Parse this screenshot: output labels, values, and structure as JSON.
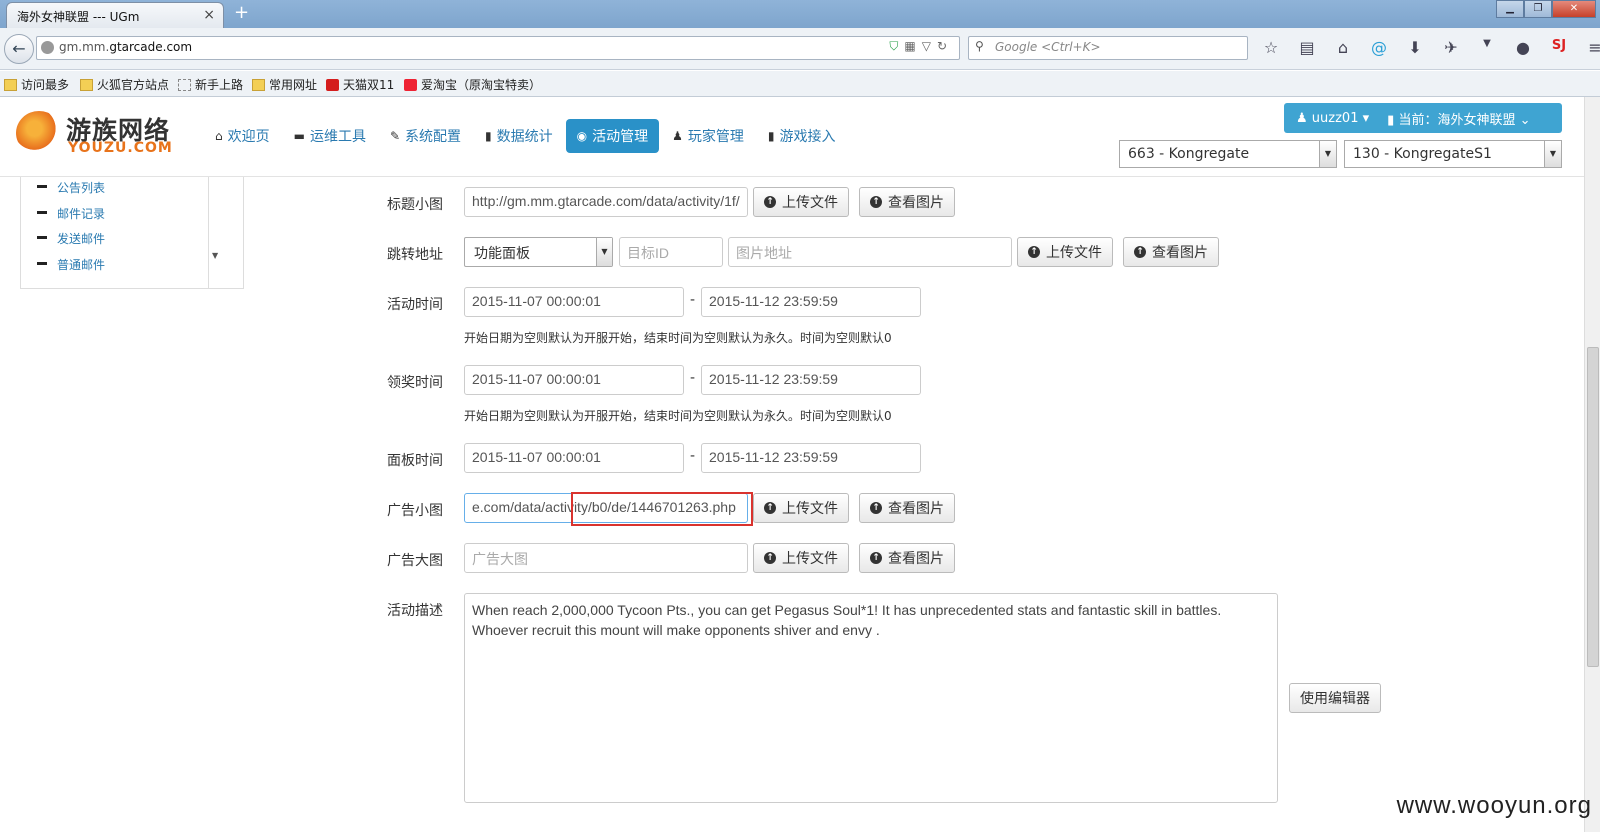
{
  "browser": {
    "tab_title": "海外女神联盟 --- UGm",
    "tab_close": "×",
    "new_tab": "+",
    "url_prefix": "gm.mm.",
    "url_domain": "gtarcade.com",
    "search_placeholder": "Google <Ctrl+K>",
    "bookmarks": [
      "访问最多",
      "火狐官方站点",
      "新手上路",
      "常用网址",
      "天猫双11",
      "爱淘宝（原淘宝特卖）"
    ]
  },
  "header": {
    "logo_cn": "游族网络",
    "logo_en": "YOUZU.COM",
    "nav": [
      {
        "label": "欢迎页",
        "icon": "home-icon"
      },
      {
        "label": "运维工具",
        "icon": "hdd-icon"
      },
      {
        "label": "系统配置",
        "icon": "wrench-icon"
      },
      {
        "label": "数据统计",
        "icon": "signal-icon"
      },
      {
        "label": "活动管理",
        "icon": "globe-icon"
      },
      {
        "label": "玩家管理",
        "icon": "user-icon"
      },
      {
        "label": "游戏接入",
        "icon": "book-icon"
      }
    ],
    "user": "uuzz01",
    "current_label": "当前：",
    "current_game": "海外女神联盟",
    "server_group": "663 - Kongregate",
    "server": "130 - KongregateS1"
  },
  "sidebar": {
    "items": [
      "公告列表",
      "邮件记录",
      "发送邮件",
      "普通邮件"
    ]
  },
  "form": {
    "title_icon_label": "标题小图",
    "title_icon_value": "http://gm.mm.gtarcade.com/data/activity/1f/",
    "redirect_label": "跳转地址",
    "redirect_type": "功能面板",
    "target_id_placeholder": "目标ID",
    "image_url_placeholder": "图片地址",
    "activity_time_label": "活动时间",
    "activity_start": "2015-11-07 00:00:01",
    "activity_end": "2015-11-12 23:59:59",
    "reward_time_label": "领奖时间",
    "reward_start": "2015-11-07 00:00:01",
    "reward_end": "2015-11-12 23:59:59",
    "panel_time_label": "面板时间",
    "panel_start": "2015-11-07 00:00:01",
    "panel_end": "2015-11-12 23:59:59",
    "time_help": "开始日期为空则默认为开服开始，结束时间为空则默认为永久。时间为空则默认0",
    "ad_small_label": "广告小图",
    "ad_small_value": "e.com/data/activity/b0/de/1446701263.php",
    "ad_large_label": "广告大图",
    "ad_large_placeholder": "广告大图",
    "desc_label": "活动描述",
    "desc_line1": "When reach 2,000,000 Tycoon Pts., you can get Pegasus Soul*1!  It has unprecedented stats and fantastic skill in battles.",
    "desc_line2": "Whoever recruit this mount will make opponents shiver and envy .",
    "upload_label": "上传文件",
    "view_label": "查看图片",
    "editor_label": "使用编辑器",
    "range_sep": "-"
  },
  "watermark": "www.wooyun.org"
}
